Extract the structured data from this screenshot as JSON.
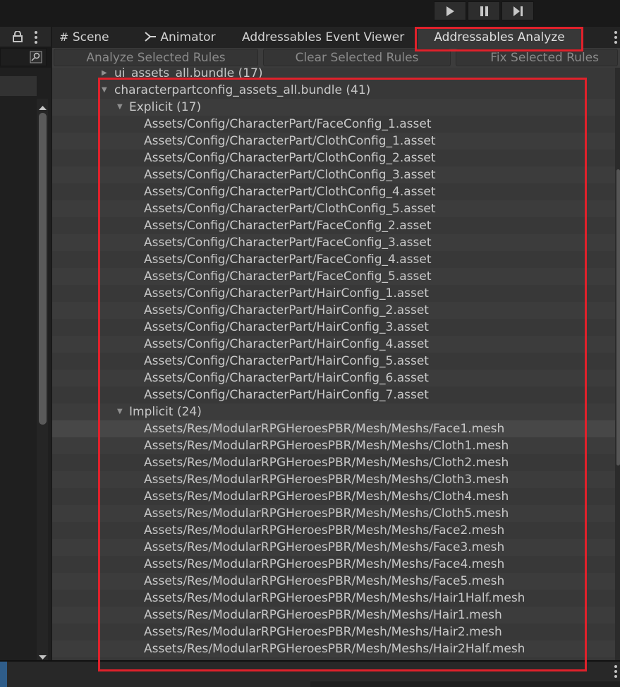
{
  "tabs": [
    {
      "label": "Scene",
      "icon": "grid-icon"
    },
    {
      "label": "Animator",
      "icon": "animator-icon"
    },
    {
      "label": "Addressables Event Viewer"
    },
    {
      "label": "Addressables Analyze",
      "active": true
    }
  ],
  "toolbar": {
    "analyze_label": "Analyze Selected Rules",
    "clear_label": "Clear Selected Rules",
    "fix_label": "Fix Selected Rules"
  },
  "play_controls": [
    "play-icon",
    "pause-icon",
    "step-icon"
  ],
  "tree": {
    "cut_row": "ui_assets_all.bundle (17)",
    "bundle": "characterpartconfig_assets_all.bundle (41)",
    "explicit_header": "Explicit (17)",
    "explicit": [
      "Assets/Config/CharacterPart/FaceConfig_1.asset",
      "Assets/Config/CharacterPart/ClothConfig_1.asset",
      "Assets/Config/CharacterPart/ClothConfig_2.asset",
      "Assets/Config/CharacterPart/ClothConfig_3.asset",
      "Assets/Config/CharacterPart/ClothConfig_4.asset",
      "Assets/Config/CharacterPart/ClothConfig_5.asset",
      "Assets/Config/CharacterPart/FaceConfig_2.asset",
      "Assets/Config/CharacterPart/FaceConfig_3.asset",
      "Assets/Config/CharacterPart/FaceConfig_4.asset",
      "Assets/Config/CharacterPart/FaceConfig_5.asset",
      "Assets/Config/CharacterPart/HairConfig_1.asset",
      "Assets/Config/CharacterPart/HairConfig_2.asset",
      "Assets/Config/CharacterPart/HairConfig_3.asset",
      "Assets/Config/CharacterPart/HairConfig_4.asset",
      "Assets/Config/CharacterPart/HairConfig_5.asset",
      "Assets/Config/CharacterPart/HairConfig_6.asset",
      "Assets/Config/CharacterPart/HairConfig_7.asset"
    ],
    "implicit_header": "Implicit (24)",
    "implicit": [
      "Assets/Res/ModularRPGHeroesPBR/Mesh/Meshs/Face1.mesh",
      "Assets/Res/ModularRPGHeroesPBR/Mesh/Meshs/Cloth1.mesh",
      "Assets/Res/ModularRPGHeroesPBR/Mesh/Meshs/Cloth2.mesh",
      "Assets/Res/ModularRPGHeroesPBR/Mesh/Meshs/Cloth3.mesh",
      "Assets/Res/ModularRPGHeroesPBR/Mesh/Meshs/Cloth4.mesh",
      "Assets/Res/ModularRPGHeroesPBR/Mesh/Meshs/Cloth5.mesh",
      "Assets/Res/ModularRPGHeroesPBR/Mesh/Meshs/Face2.mesh",
      "Assets/Res/ModularRPGHeroesPBR/Mesh/Meshs/Face3.mesh",
      "Assets/Res/ModularRPGHeroesPBR/Mesh/Meshs/Face4.mesh",
      "Assets/Res/ModularRPGHeroesPBR/Mesh/Meshs/Face5.mesh",
      "Assets/Res/ModularRPGHeroesPBR/Mesh/Meshs/Hair1Half.mesh",
      "Assets/Res/ModularRPGHeroesPBR/Mesh/Meshs/Hair1.mesh",
      "Assets/Res/ModularRPGHeroesPBR/Mesh/Meshs/Hair2.mesh",
      "Assets/Res/ModularRPGHeroesPBR/Mesh/Meshs/Hair2Half.mesh"
    ]
  },
  "colors": {
    "annotation": "#e0212b",
    "panel": "#383838",
    "toolbar": "#3c3c3c"
  }
}
